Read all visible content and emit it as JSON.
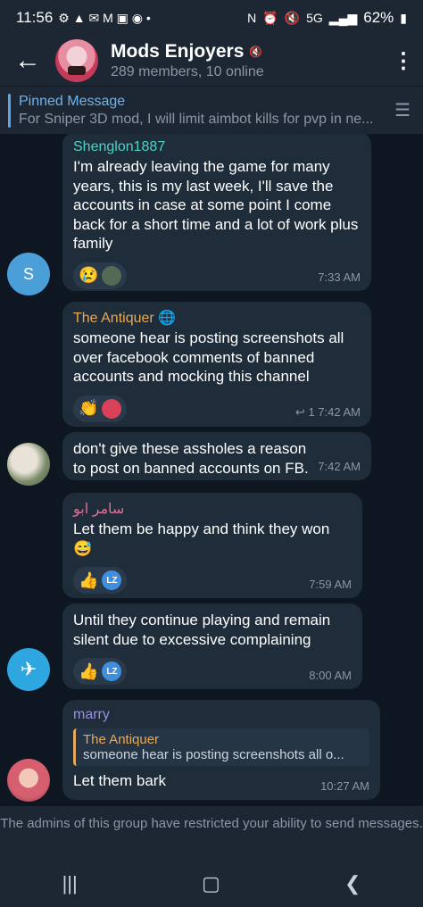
{
  "status": {
    "time": "11:56",
    "network": "5G",
    "battery": "62%"
  },
  "header": {
    "title": "Mods Enjoyers",
    "subtitle": "289 members, 10 online"
  },
  "pinned": {
    "title": "Pinned Message",
    "text": "For Sniper 3D mod, I will limit aimbot kills for pvp in ne..."
  },
  "messages": [
    {
      "sender": "Shenglon1887",
      "sender_color": "#4fd1c5",
      "text": "I'm already leaving the game for many years, this is my last week, I'll save the accounts in case at some point I come back for a short time and a lot of work plus family",
      "time": "7:33 AM",
      "reactions": [
        "😢"
      ],
      "avatar_letter": "S"
    },
    {
      "sender": "The Antiquer",
      "sender_color": "#e6a85a",
      "text": "someone hear is posting screenshots all over facebook comments of banned accounts and mocking this channel",
      "time": "7:42 AM",
      "replies": "1",
      "reactions": [
        "👏"
      ]
    },
    {
      "text": "don't give these assholes a reason to post on banned accounts on FB.",
      "time": "7:42 AM"
    },
    {
      "sender": "سامر ابو",
      "sender_color": "#e0709a",
      "text": "Let them be happy and think they won 😅",
      "time": "7:59 AM",
      "reactions": [
        "👍"
      ],
      "lz": "LZ"
    },
    {
      "text": "Until they continue playing and remain silent due to excessive complaining",
      "time": "8:00 AM",
      "reactions": [
        "👍"
      ],
      "lz": "LZ"
    },
    {
      "sender": "marry",
      "sender_color": "#9a8ee0",
      "quote_name": "The Antiquer",
      "quote_text": "someone hear is posting screenshots all o...",
      "text": "Let them bark",
      "time": "10:27 AM"
    }
  ],
  "footer": {
    "restriction": "The admins of this group have restricted your ability to send messages."
  },
  "colors": {
    "background": "#0e1621",
    "bubble": "#1f2c3a",
    "accent": "#5ea5e0"
  }
}
